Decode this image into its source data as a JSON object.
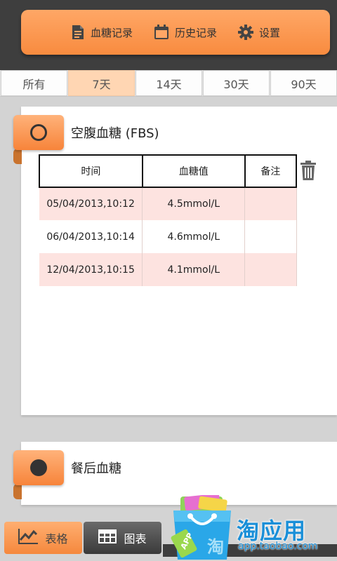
{
  "nav": {
    "items": [
      {
        "label": "血糖记录",
        "icon": "document-icon"
      },
      {
        "label": "历史记录",
        "icon": "calendar-icon"
      },
      {
        "label": "设置",
        "icon": "gear-icon"
      }
    ]
  },
  "tabs": [
    {
      "label": "所有",
      "active": false
    },
    {
      "label": "7天",
      "active": true
    },
    {
      "label": "14天",
      "active": false
    },
    {
      "label": "30天",
      "active": false
    },
    {
      "label": "90天",
      "active": false
    }
  ],
  "fbs_card": {
    "title": "空腹血糖 (FBS)",
    "columns": [
      "时间",
      "血糖值",
      "备注"
    ],
    "rows": [
      {
        "time": "05/04/2013,10:12",
        "value": "4.5mmol/L",
        "note": ""
      },
      {
        "time": "06/04/2013,10:14",
        "value": "4.6mmol/L",
        "note": ""
      },
      {
        "time": "12/04/2013,10:15",
        "value": "4.1mmol/L",
        "note": ""
      }
    ]
  },
  "post_meal_card": {
    "title": "餐后血糖"
  },
  "bottom": {
    "table_label": "表格",
    "chart_label": "图表"
  },
  "watermark": {
    "brand": "淘应用",
    "url": "app.taobao.com",
    "badge": "APP",
    "badge_char": "淘"
  },
  "colors": {
    "accent": "#f88b3f",
    "dark": "#3e3e3e",
    "row_highlight": "#fde3e0",
    "brand_blue": "#1a8fd8"
  }
}
